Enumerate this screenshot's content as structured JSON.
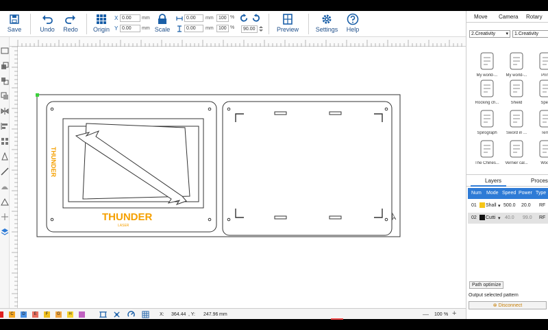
{
  "toolbar": {
    "save": "Save",
    "undo": "Undo",
    "redo": "Redo",
    "origin": "Origin",
    "scale": "Scale",
    "preview": "Preview",
    "settings": "Settings",
    "help": "Help",
    "x_label": "X",
    "y_label": "Y",
    "x_value": "0.00",
    "y_value": "0.00",
    "w_value": "0.00",
    "h_value": "0.00",
    "w_pct": "100",
    "h_pct": "100",
    "unit_mm": "mm",
    "pct": "%",
    "rotation": "90.00"
  },
  "rightpanel": {
    "tabs": [
      "Move",
      "Camera",
      "Rotary"
    ],
    "category": "2.Creativity",
    "subcategory": "1.Creativity",
    "library": [
      {
        "cap": "My world-..."
      },
      {
        "cap": "My world-..."
      },
      {
        "cap": "Printi"
      },
      {
        "cap": "Rocking ch..."
      },
      {
        "cap": "Shield"
      },
      {
        "cap": "Spect"
      },
      {
        "cap": "Spirograph"
      },
      {
        "cap": "Sword in ..."
      },
      {
        "cap": "Terra"
      },
      {
        "cap": "The Chines..."
      },
      {
        "cap": "Vernier cal..."
      },
      {
        "cap": "Wood"
      }
    ],
    "layer_tabs": [
      "Layers",
      "Process"
    ],
    "layer_headers": [
      "Num",
      "Mode",
      "Speed",
      "Power",
      "Type"
    ],
    "layers": [
      {
        "num": "01",
        "mode": "Shall",
        "speed": "500.0",
        "power": "20.0",
        "type": "RF",
        "color": "#f5c518"
      },
      {
        "num": "02",
        "mode": "Cutti",
        "speed": "40.0",
        "power": "99.0",
        "type": "RF",
        "color": "#111111"
      }
    ],
    "path_optimize": "Path optimize",
    "output_selected": "Output selected pattern",
    "disconnect": "Disconnect"
  },
  "statusbar": {
    "swatches": [
      {
        "label": "",
        "color": "#e02020"
      },
      {
        "label": "C",
        "color": "#f5a623"
      },
      {
        "label": "D",
        "color": "#4a90e2"
      },
      {
        "label": "E",
        "color": "#e87060"
      },
      {
        "label": "F",
        "color": "#f0c020"
      },
      {
        "label": "G",
        "color": "#f2a640"
      },
      {
        "label": "H",
        "color": "#f7d330"
      },
      {
        "label": "",
        "color": "#c060c0"
      }
    ],
    "x_label": "X:",
    "x_value": "364.44",
    "y_label": ", Y:",
    "y_value": "247.96",
    "unit": "mm",
    "zoom": "100",
    "zoom_unit": "%",
    "minus": "—",
    "plus": "+"
  },
  "canvas": {
    "logo_text": "THUNDER",
    "logo_sub": "LASER",
    "logo_side": "THUNDER",
    "accent": "#f5a000"
  }
}
